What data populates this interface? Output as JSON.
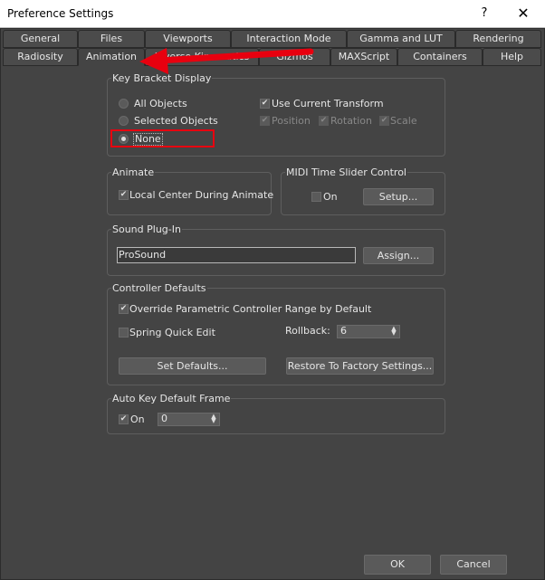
{
  "window": {
    "title": "Preference Settings",
    "help_glyph": "?",
    "close_glyph": "✕"
  },
  "tabs_row1": [
    "General",
    "Files",
    "Viewports",
    "Interaction Mode",
    "Gamma and LUT",
    "Rendering"
  ],
  "tabs_row2": [
    "Radiosity",
    "Animation",
    "Inverse Kinematics",
    "Gizmos",
    "MAXScript",
    "Containers",
    "Help"
  ],
  "key_bracket": {
    "title": "Key Bracket Display",
    "options": [
      "All Objects",
      "Selected Objects",
      "None"
    ],
    "selected": "None",
    "use_current_transform": "Use Current Transform",
    "position": "Position",
    "rotation": "Rotation",
    "scale": "Scale"
  },
  "animate": {
    "title": "Animate",
    "local_center": "Local Center During Animate"
  },
  "midi": {
    "title": "MIDI Time Slider Control",
    "on": "On",
    "setup": "Setup..."
  },
  "sound": {
    "title": "Sound Plug-In",
    "value": "ProSound",
    "assign": "Assign..."
  },
  "controller": {
    "title": "Controller Defaults",
    "override": "Override Parametric Controller Range by Default",
    "spring": "Spring Quick Edit",
    "rollback_label": "Rollback:",
    "rollback_value": "6",
    "set_defaults": "Set Defaults...",
    "restore": "Restore To Factory Settings..."
  },
  "auto_key": {
    "title": "Auto Key Default Frame",
    "on": "On",
    "value": "0"
  },
  "footer": {
    "ok": "OK",
    "cancel": "Cancel"
  },
  "annotation": {
    "color": "#e8000f"
  }
}
